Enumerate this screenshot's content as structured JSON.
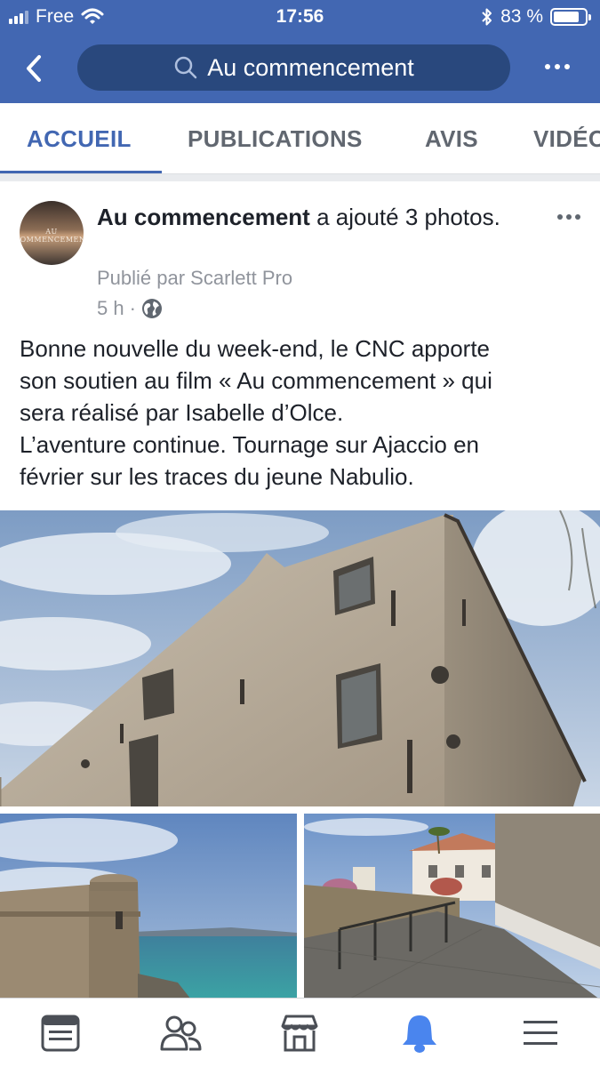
{
  "status_bar": {
    "carrier": "Free",
    "time": "17:56",
    "battery_percent": "83 %",
    "battery_level": 0.83
  },
  "header": {
    "search_text": "Au commencement",
    "brand_color": "#4267b2"
  },
  "tabs": [
    {
      "label": "ACCUEIL",
      "active": true
    },
    {
      "label": "PUBLICATIONS",
      "active": false
    },
    {
      "label": "AVIS",
      "active": false
    },
    {
      "label": "VIDÉOS",
      "active": false
    }
  ],
  "post": {
    "avatar_text": "AU COMMENCEMENT",
    "page_name": "Au commencement",
    "action_text": "a ajouté 3 photos.",
    "published_by": "Publié par Scarlett Pro",
    "time_ago": "5 h",
    "separator": "·",
    "body_lines": [
      "Bonne nouvelle du week-end, le CNC apporte",
      "son soutien au film « Au commencement » qui",
      "sera réalisé par Isabelle d’Olce.",
      "L’aventure continue. Tournage sur Ajaccio  en",
      "février sur les traces du jeune Nabulio."
    ],
    "photo_count": 3
  },
  "bottom_nav": [
    {
      "icon": "news-feed-icon",
      "active": false
    },
    {
      "icon": "friends-icon",
      "active": false
    },
    {
      "icon": "marketplace-icon",
      "active": false
    },
    {
      "icon": "notifications-bell-icon",
      "active": true
    },
    {
      "icon": "menu-icon",
      "active": false
    }
  ]
}
